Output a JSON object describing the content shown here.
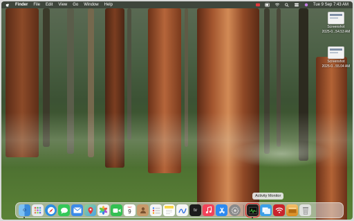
{
  "menubar": {
    "app_name": "Finder",
    "menus": [
      "File",
      "Edit",
      "View",
      "Go",
      "Window",
      "Help"
    ],
    "clock": "Tue 9 Sep  7:43 AM"
  },
  "desktop": {
    "items": [
      {
        "name_line1": "Screenshot",
        "name_line2": "2025-0...54.53 AM"
      },
      {
        "name_line1": "Screenshot",
        "name_line2": "2025-0...55.04 AM"
      }
    ]
  },
  "dock": {
    "tooltip": "Activity Monitor",
    "apps": [
      {
        "icon": "finder-icon",
        "color": "#3d8ce0"
      },
      {
        "icon": "launchpad-icon",
        "color": "#e9eaee"
      },
      {
        "icon": "safari-icon",
        "color": "#2d8de0"
      },
      {
        "icon": "messages-icon",
        "color": "#35c859"
      },
      {
        "icon": "mail-icon",
        "color": "#3c8be8"
      },
      {
        "icon": "maps-icon",
        "color": "#5cb85c"
      },
      {
        "icon": "photos-icon",
        "color": "#f2f2f2"
      },
      {
        "icon": "facetime-icon",
        "color": "#33c052"
      },
      {
        "icon": "calendar-icon",
        "color": "#ffffff",
        "text": "9"
      },
      {
        "icon": "contacts-icon",
        "color": "#c79a6a"
      },
      {
        "icon": "reminders-icon",
        "color": "#f4f4f4"
      },
      {
        "icon": "notes-icon",
        "color": "#f7d84c"
      },
      {
        "icon": "freeform-icon",
        "color": "#f5f5f5"
      },
      {
        "icon": "tv-icon",
        "color": "#1c1c1c",
        "text": "tv"
      },
      {
        "icon": "music-icon",
        "color": "#f2435a"
      },
      {
        "icon": "app-store-icon",
        "color": "#2e8af0"
      },
      {
        "icon": "system-settings-icon",
        "color": "#8a8a8a"
      },
      {
        "icon": "activity-monitor-icon",
        "color": "#1d1d1d"
      },
      {
        "icon": "preview-icon",
        "color": "#3aa0e8"
      },
      {
        "icon": "wifi-app-icon",
        "color": "#c8242c"
      },
      {
        "icon": "archive-utility-icon",
        "color": "#e9a63a"
      },
      {
        "icon": "trash-icon",
        "color": "#d9d9d9"
      }
    ]
  }
}
